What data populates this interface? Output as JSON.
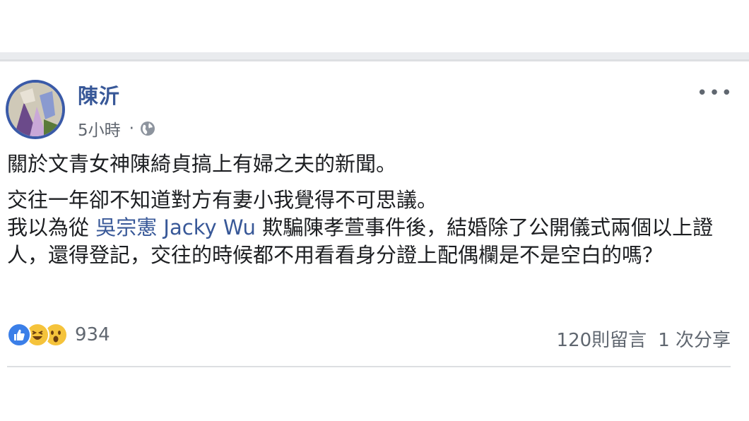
{
  "post": {
    "author": "陳沂",
    "timestamp": "5小時",
    "separator": "·",
    "privacy_icon": "globe-icon",
    "more_label": "•••",
    "paragraph1": "關於文青女神陳綺貞搞上有婦之夫的新聞。",
    "paragraph2_line1": "交往一年卻不知道對方有妻小我覺得不可思議。",
    "paragraph2_before_tag": "我以為從 ",
    "tag": "吳宗憲 Jacky Wu",
    "paragraph2_after_tag": " 欺騙陳孝萱事件後，結婚除了公開儀式兩個以上證人，還得登記，交往的時候都不用看看身分證上配偶欄是不是空白的嗎？",
    "reactions": {
      "icons": [
        "like-icon",
        "haha-icon",
        "wow-icon"
      ],
      "count": "934"
    },
    "comments": "120則留言",
    "shares": "1 次分享"
  },
  "colors": {
    "link": "#385898",
    "text": "#1c1e21",
    "secondary": "#616770",
    "like": "#3b7fe8",
    "emoji": "#f5c33b"
  }
}
